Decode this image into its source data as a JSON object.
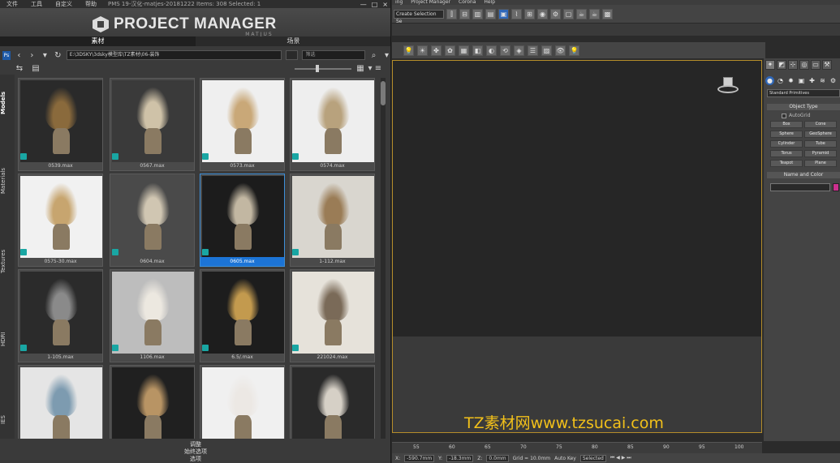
{
  "pm": {
    "menu": [
      "文件",
      "工具",
      "自定义",
      "帮助"
    ],
    "title_info": "PMS 19-汉化-matjes-20181222    Items: 308    Selected: 1",
    "window_controls": [
      "—",
      "□",
      "×"
    ],
    "logo_title": "PROJECT MANAGER",
    "logo_sub": "MATJUS",
    "tabs": [
      "素材",
      "场景"
    ],
    "path": "E:\\3DSKY\\3dsky模型库\\TZ素材\\06-装饰",
    "search_placeholder": "筛选",
    "sidebar_tabs": [
      "Models",
      "Materials",
      "Textures",
      "HDRI",
      "IES"
    ],
    "items": [
      {
        "name": "0539.max",
        "bg": "#2a2a2a",
        "accent": "#8a6a3c"
      },
      {
        "name": "0567.max",
        "bg": "#3a3a3a",
        "accent": "#cfc2a8"
      },
      {
        "name": "0573.max",
        "bg": "#efefef",
        "accent": "#c9a878"
      },
      {
        "name": "0574.max",
        "bg": "#eeeeee",
        "accent": "#b8a27d"
      },
      {
        "name": "0575-30.max",
        "bg": "#f1f1f1",
        "accent": "#c7a56f"
      },
      {
        "name": "0604.max",
        "bg": "#4a4a4a",
        "accent": "#d0c6b2"
      },
      {
        "name": "0605.max",
        "bg": "#1c1c1c",
        "accent": "#c2b7a2",
        "selected": true
      },
      {
        "name": "1-112.max",
        "bg": "#d9d6cf",
        "accent": "#9a7c56"
      },
      {
        "name": "1-105.max",
        "bg": "#2b2b2b",
        "accent": "#8a8a8a"
      },
      {
        "name": "1106.max",
        "bg": "#bdbdbd",
        "accent": "#ece8e0"
      },
      {
        "name": "6.5/.max",
        "bg": "#1d1d1d",
        "accent": "#c39a4e"
      },
      {
        "name": "221024.max",
        "bg": "#e6e2da",
        "accent": "#7a6a58"
      },
      {
        "name": "",
        "bg": "#e5e5e5",
        "accent": "#7d9bb0"
      },
      {
        "name": "",
        "bg": "#202020",
        "accent": "#b89464"
      },
      {
        "name": "",
        "bg": "#f0f0f0",
        "accent": "#ece8e4"
      },
      {
        "name": "",
        "bg": "#2a2a2a",
        "accent": "#d6d0c6"
      }
    ],
    "footer": [
      "调整",
      "始终选项",
      "选项"
    ]
  },
  "max": {
    "menu": [
      "ing",
      "Project Manager",
      "Corona",
      "Help"
    ],
    "selection_set": "Create Selection Se",
    "primitive_type": "Standard Primitives",
    "object_type_label": "Object Type",
    "autogrid_label": "AutoGrid",
    "primitives": [
      "Box",
      "Cone",
      "Sphere",
      "GeoSphere",
      "Cylinder",
      "Tube",
      "Torus",
      "Pyramid",
      "Teapot",
      "Plane"
    ],
    "name_color_label": "Name and Color",
    "timeline_ticks": [
      "55",
      "60",
      "65",
      "70",
      "75",
      "80",
      "85",
      "90",
      "95",
      "100"
    ],
    "status": {
      "x_label": "X:",
      "x_value": "-590.7mm",
      "y_label": "Y:",
      "y_value": "-18.3mm",
      "z_label": "Z:",
      "z_value": "0.0mm",
      "grid": "Grid = 10.0mm",
      "autokey": "Auto Key",
      "selected": "Selected"
    },
    "watermark": "TZ素材网www.tzsucai.com"
  },
  "colors": {
    "selection_blue": "#1c74d6",
    "viewport_border": "#b58d2a",
    "format_icon": "#19a6a3",
    "watermark": "#f2c01a",
    "swatch": "#cc2f8e"
  }
}
